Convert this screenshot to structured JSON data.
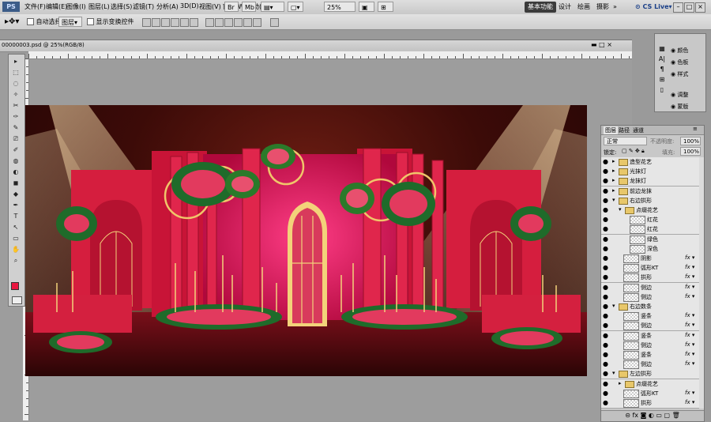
{
  "app": {
    "logo": "PS"
  },
  "menu": [
    "文件(F)",
    "编辑(E)",
    "图像(I)",
    "图层(L)",
    "选择(S)",
    "滤镜(T)",
    "分析(A)",
    "3D(D)",
    "视图(V)",
    "窗口(W)",
    "帮助(H)"
  ],
  "zoom": "25%",
  "workspaces": [
    "基本功能",
    "设计",
    "绘画",
    "摄影"
  ],
  "cslive": "CS Live",
  "options": {
    "auto_select": "自动选择:",
    "auto_select_value": "图层",
    "transform": "显示变换控件"
  },
  "document": {
    "tab_title": "00000003.psd @ 25%(RGB/8)"
  },
  "mini_panels": [
    "颜色",
    "色板",
    "样式",
    "调整",
    "蒙版"
  ],
  "layers_panel": {
    "tabs": [
      "图层",
      "路径",
      "通道"
    ],
    "blend_mode": "正常",
    "opacity_label": "不透明度:",
    "opacity": "100%",
    "lock_label": "锁定:",
    "fill_label": "填充:",
    "fill": "100%",
    "rows": [
      {
        "name": "造型花艺",
        "type": "folder",
        "indent": 0
      },
      {
        "name": "光抹灯",
        "type": "folder",
        "indent": 0
      },
      {
        "name": "龙抹灯",
        "type": "folder",
        "indent": 0
      },
      {
        "name": "前边龙抹",
        "type": "folder",
        "indent": 0
      },
      {
        "name": "右边拱形",
        "type": "folder-open",
        "indent": 0
      },
      {
        "name": "点缀花艺",
        "type": "folder-open",
        "indent": 1
      },
      {
        "name": "红花",
        "type": "layer",
        "indent": 2
      },
      {
        "name": "红花",
        "type": "layer",
        "indent": 2
      },
      {
        "name": "绿色",
        "type": "layer",
        "indent": 2
      },
      {
        "name": "深色",
        "type": "layer",
        "indent": 2
      },
      {
        "name": "阴影",
        "type": "layer",
        "indent": 1,
        "fx": true
      },
      {
        "name": "弧形KT",
        "type": "layer",
        "indent": 1,
        "fx": true
      },
      {
        "name": "拱形",
        "type": "layer",
        "indent": 1,
        "fx": true
      },
      {
        "name": "侧边",
        "type": "layer",
        "indent": 1,
        "fx": true
      },
      {
        "name": "侧边",
        "type": "layer",
        "indent": 1,
        "fx": true
      },
      {
        "name": "右边数条",
        "type": "folder-open",
        "indent": 0
      },
      {
        "name": "竖条",
        "type": "layer",
        "indent": 1,
        "fx": true
      },
      {
        "name": "侧边",
        "type": "layer",
        "indent": 1,
        "fx": true
      },
      {
        "name": "竖条",
        "type": "layer",
        "indent": 1,
        "fx": true
      },
      {
        "name": "侧边",
        "type": "layer",
        "indent": 1,
        "fx": true
      },
      {
        "name": "竖条",
        "type": "layer",
        "indent": 1,
        "fx": true
      },
      {
        "name": "侧边",
        "type": "layer",
        "indent": 1,
        "fx": true
      },
      {
        "name": "左边拱形",
        "type": "folder-open",
        "indent": 0
      },
      {
        "name": "点缀花艺",
        "type": "folder",
        "indent": 1
      },
      {
        "name": "弧形KT",
        "type": "layer",
        "indent": 1,
        "fx": true
      },
      {
        "name": "拱形",
        "type": "layer",
        "indent": 1,
        "fx": true
      }
    ]
  },
  "colors": {
    "foreground": "#e8163f",
    "background": "#ffffff",
    "accent": "#d9214a",
    "gold": "#e8c06a"
  }
}
